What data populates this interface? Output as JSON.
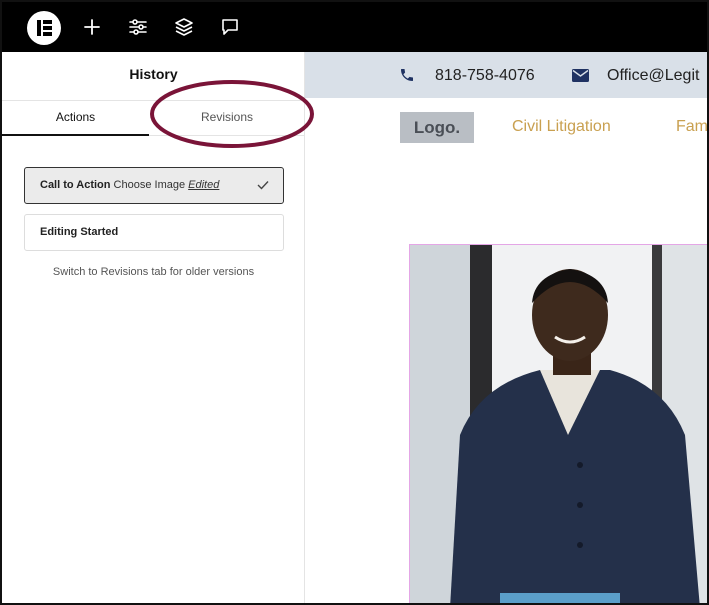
{
  "toolbar": {
    "logo": "elementor-logo",
    "icons": [
      "plus-icon",
      "sliders-icon",
      "layers-icon",
      "comment-icon"
    ]
  },
  "sidebar": {
    "title": "History",
    "tabs": [
      {
        "label": "Actions",
        "active": true
      },
      {
        "label": "Revisions",
        "active": false
      }
    ],
    "items": [
      {
        "title": "Call to Action",
        "action": "Choose Image",
        "status": "Edited",
        "current": true
      },
      {
        "title": "Editing Started",
        "action": "",
        "status": "",
        "current": false
      }
    ],
    "hint": "Switch to Revisions tab for older versions"
  },
  "preview": {
    "phone": "818-758-4076",
    "email": "Office@Legit",
    "logo_text": "Logo.",
    "nav": [
      "Civil Litigation",
      "Fam"
    ]
  },
  "colors": {
    "annotation_circle": "#7a1438",
    "nav_link": "#c9a050",
    "contact_bar": "#d9e0e8",
    "icon_navy": "#1f3262",
    "image_border": "#e4a6e6"
  }
}
